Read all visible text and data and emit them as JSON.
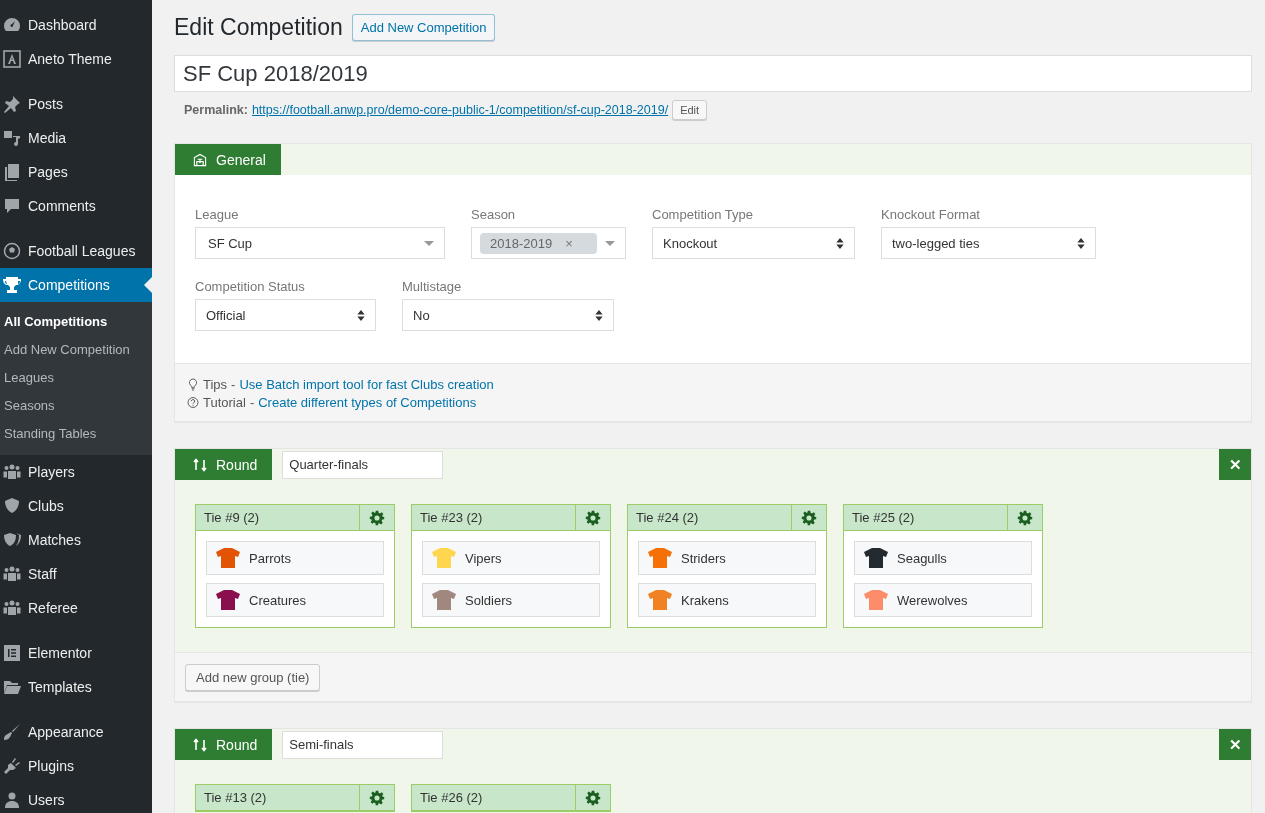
{
  "sidebar": {
    "groups": [
      {
        "items": [
          {
            "label": "Dashboard",
            "selected": false
          },
          {
            "label": "Aneto Theme",
            "selected": false
          }
        ]
      },
      {
        "items": [
          {
            "label": "Posts",
            "selected": false
          },
          {
            "label": "Media",
            "selected": false
          },
          {
            "label": "Pages",
            "selected": false
          },
          {
            "label": "Comments",
            "selected": false
          }
        ]
      },
      {
        "items": [
          {
            "label": "Football Leagues",
            "selected": false
          },
          {
            "label": "Competitions",
            "selected": true,
            "children": [
              {
                "label": "All Competitions",
                "selected": true
              },
              {
                "label": "Add New Competition",
                "selected": false
              },
              {
                "label": "Leagues",
                "selected": false
              },
              {
                "label": "Seasons",
                "selected": false
              },
              {
                "label": "Standing Tables",
                "selected": false
              }
            ]
          },
          {
            "label": "Players",
            "selected": false
          },
          {
            "label": "Clubs",
            "selected": false
          },
          {
            "label": "Matches",
            "selected": false
          },
          {
            "label": "Staff",
            "selected": false
          },
          {
            "label": "Referee",
            "selected": false
          }
        ]
      },
      {
        "items": [
          {
            "label": "Elementor",
            "selected": false
          },
          {
            "label": "Templates",
            "selected": false
          }
        ]
      },
      {
        "items": [
          {
            "label": "Appearance",
            "selected": false
          },
          {
            "label": "Plugins",
            "selected": false
          },
          {
            "label": "Users",
            "selected": false
          }
        ]
      }
    ]
  },
  "header": {
    "title": "Edit Competition",
    "add_button": "Add New Competition"
  },
  "title_field": {
    "value": "SF Cup 2018/2019"
  },
  "permalink": {
    "label": "Permalink:",
    "url": "https://football.anwp.pro/demo-core-public-1/competition/sf-cup-2018-2019/",
    "edit_button": "Edit"
  },
  "general": {
    "tab": "General",
    "rows": [
      [
        {
          "label": "League",
          "kind": "dropdown",
          "value": "SF Cup"
        },
        {
          "label": "Season",
          "kind": "dropdown",
          "tags": [
            "2018-2019"
          ],
          "remove": "×"
        },
        {
          "label": "Competition Type",
          "kind": "select",
          "value": "Knockout"
        },
        {
          "label": "Knockout Format",
          "kind": "select",
          "value": "two-legged ties"
        }
      ],
      [
        {
          "label": "Competition Status",
          "kind": "select",
          "value": "Official"
        },
        {
          "label": "Multistage",
          "kind": "select",
          "value": "No"
        }
      ]
    ],
    "notes": [
      {
        "kind": "tip",
        "label": "Tips",
        "sep": "-",
        "link": "Use Batch import tool for fast Clubs creation"
      },
      {
        "kind": "tutorial",
        "label": "Tutorial",
        "sep": "-",
        "link": "Create different types of Competitions"
      }
    ]
  },
  "rounds": [
    {
      "tab": "Round",
      "title": "Quarter-finals",
      "close": "✕",
      "add_button": "Add new group (tie)",
      "ties": [
        {
          "title": "Tie #9 (2)",
          "teams": [
            {
              "name": "Parrots",
              "color": "#e25303"
            },
            {
              "name": "Creatures",
              "color": "#8a0f4e"
            }
          ]
        },
        {
          "title": "Tie #23 (2)",
          "teams": [
            {
              "name": "Vipers",
              "color": "#ffd64f"
            },
            {
              "name": "Soldiers",
              "color": "#a1887f"
            }
          ]
        },
        {
          "title": "Tie #24 (2)",
          "teams": [
            {
              "name": "Striders",
              "color": "#f57006"
            },
            {
              "name": "Krakens",
              "color": "#f08223"
            }
          ]
        },
        {
          "title": "Tie #25 (2)",
          "teams": [
            {
              "name": "Seagulls",
              "color": "#232a30"
            },
            {
              "name": "Werewolves",
              "color": "#fc8c6a"
            }
          ]
        }
      ]
    },
    {
      "tab": "Round",
      "title": "Semi-finals",
      "close": "✕",
      "ties": [
        {
          "title": "Tie #13 (2)"
        },
        {
          "title": "Tie #26 (2)"
        }
      ]
    }
  ]
}
